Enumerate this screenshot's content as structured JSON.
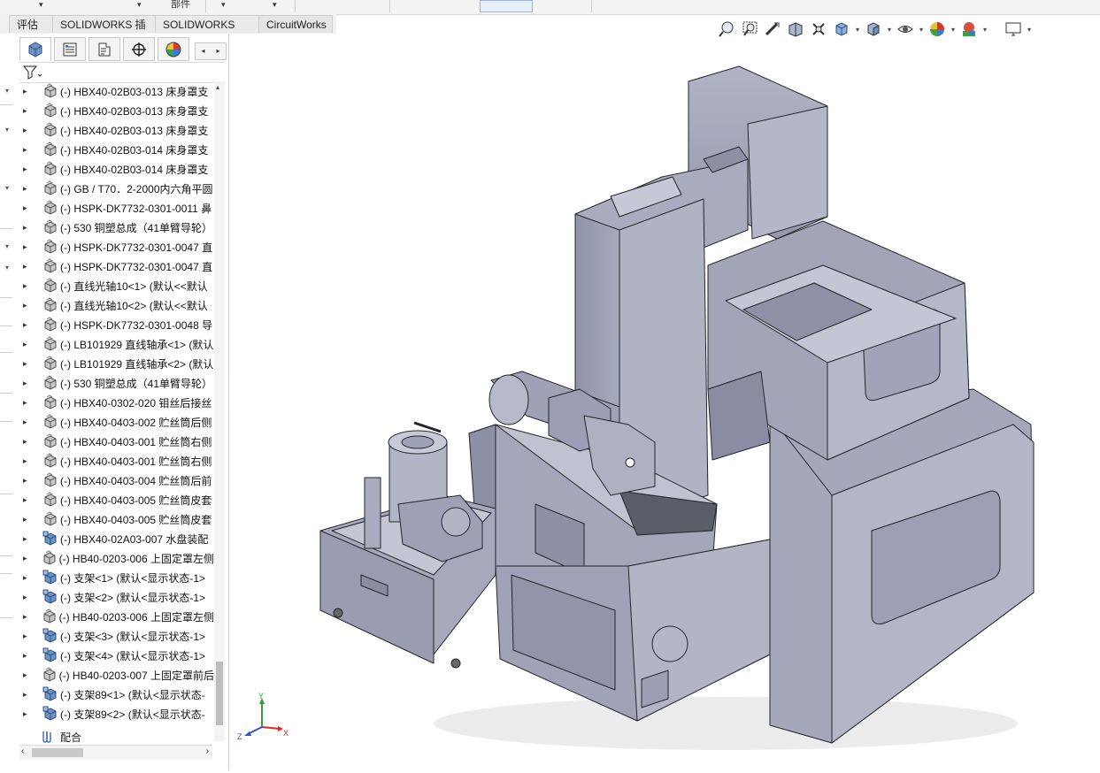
{
  "ribbon": {
    "part_label": "部件",
    "tabs": [
      {
        "label": "评估"
      },
      {
        "label": "SOLIDWORKS 插件"
      },
      {
        "label": "SOLIDWORKS MBD"
      },
      {
        "label": "CircuitWorks"
      }
    ]
  },
  "panel": {
    "tab_icons": [
      "featuremanager-icon",
      "propertymanager-icon",
      "configurationmanager-icon",
      "dimxpert-icon",
      "display-manager-icon"
    ],
    "filter_icon": "filter-icon"
  },
  "tree": {
    "items": [
      {
        "label": "(-) HBX40-02B03-013 床身罩支",
        "icon": "part"
      },
      {
        "label": "(-) HBX40-02B03-013 床身罩支",
        "icon": "part"
      },
      {
        "label": "(-) HBX40-02B03-013 床身罩支",
        "icon": "part"
      },
      {
        "label": "(-) HBX40-02B03-014 床身罩支",
        "icon": "part"
      },
      {
        "label": "(-) HBX40-02B03-014 床身罩支",
        "icon": "part"
      },
      {
        "label": "(-) GB / T70．2-2000内六角平圆",
        "icon": "part"
      },
      {
        "label": "(-) HSPK-DK7732-0301-0011 鼻",
        "icon": "part"
      },
      {
        "label": "(-) 530 铜塑总成（41单臂导轮）",
        "icon": "part"
      },
      {
        "label": "(-) HSPK-DK7732-0301-0047 直",
        "icon": "part"
      },
      {
        "label": "(-) HSPK-DK7732-0301-0047 直",
        "icon": "part"
      },
      {
        "label": "(-) 直线光轴10<1> (默认<<默认",
        "icon": "part"
      },
      {
        "label": "(-) 直线光轴10<2> (默认<<默认",
        "icon": "part"
      },
      {
        "label": "(-) HSPK-DK7732-0301-0048 导",
        "icon": "part"
      },
      {
        "label": "(-) LB101929 直线轴承<1> (默认",
        "icon": "part"
      },
      {
        "label": "(-) LB101929 直线轴承<2> (默认",
        "icon": "part"
      },
      {
        "label": "(-) 530 铜塑总成（41单臂导轮）",
        "icon": "part"
      },
      {
        "label": "(-) HBX40-0302-020  钼丝后接丝",
        "icon": "part"
      },
      {
        "label": "(-) HBX40-0403-002 贮丝筒后侧",
        "icon": "part"
      },
      {
        "label": "(-) HBX40-0403-001 贮丝筒右侧",
        "icon": "part"
      },
      {
        "label": "(-) HBX40-0403-001 贮丝筒右侧",
        "icon": "part"
      },
      {
        "label": "(-) HBX40-0403-004 贮丝筒后前",
        "icon": "part"
      },
      {
        "label": "(-) HBX40-0403-005 贮丝筒皮套",
        "icon": "part"
      },
      {
        "label": "(-) HBX40-0403-005 贮丝筒皮套",
        "icon": "part"
      },
      {
        "label": "(-) HBX40-02A03-007 水盘装配",
        "icon": "assembly"
      },
      {
        "label": "(-) HB40-0203-006 上固定罩左侧",
        "icon": "part"
      },
      {
        "label": "(-) 支架<1> (默认<显示状态-1>",
        "icon": "assembly"
      },
      {
        "label": "(-) 支架<2> (默认<显示状态-1>",
        "icon": "assembly"
      },
      {
        "label": "(-) HB40-0203-006 上固定罩左侧",
        "icon": "part"
      },
      {
        "label": "(-) 支架<3> (默认<显示状态-1>",
        "icon": "assembly"
      },
      {
        "label": "(-) 支架<4> (默认<显示状态-1>",
        "icon": "assembly"
      },
      {
        "label": "(-) HB40-0203-007 上固定罩前后",
        "icon": "part"
      },
      {
        "label": "(-) 支架89<1> (默认<显示状态-",
        "icon": "assembly"
      },
      {
        "label": "(-) 支架89<2> (默认<显示状态-",
        "icon": "assembly"
      }
    ],
    "mates_label": "配合"
  },
  "view_toolbar": {
    "icons": [
      "zoom-to-fit-icon",
      "zoom-to-area-icon",
      "previous-view-icon",
      "section-view-icon",
      "dynamic-annotation-icon",
      "view-orientation-icon",
      "display-style-icon",
      "hide-show-items-icon",
      "edit-appearance-icon",
      "apply-scene-icon",
      "view-settings-icon"
    ]
  },
  "triad": {
    "x": "X",
    "y": "Y",
    "z": "Z"
  },
  "colors": {
    "model": "#a3a6ba",
    "model_dark": "#7d8197",
    "edge": "#2a2a30",
    "part_icon": "#9a9a9a",
    "assembly_icon": "#6d93c7"
  }
}
